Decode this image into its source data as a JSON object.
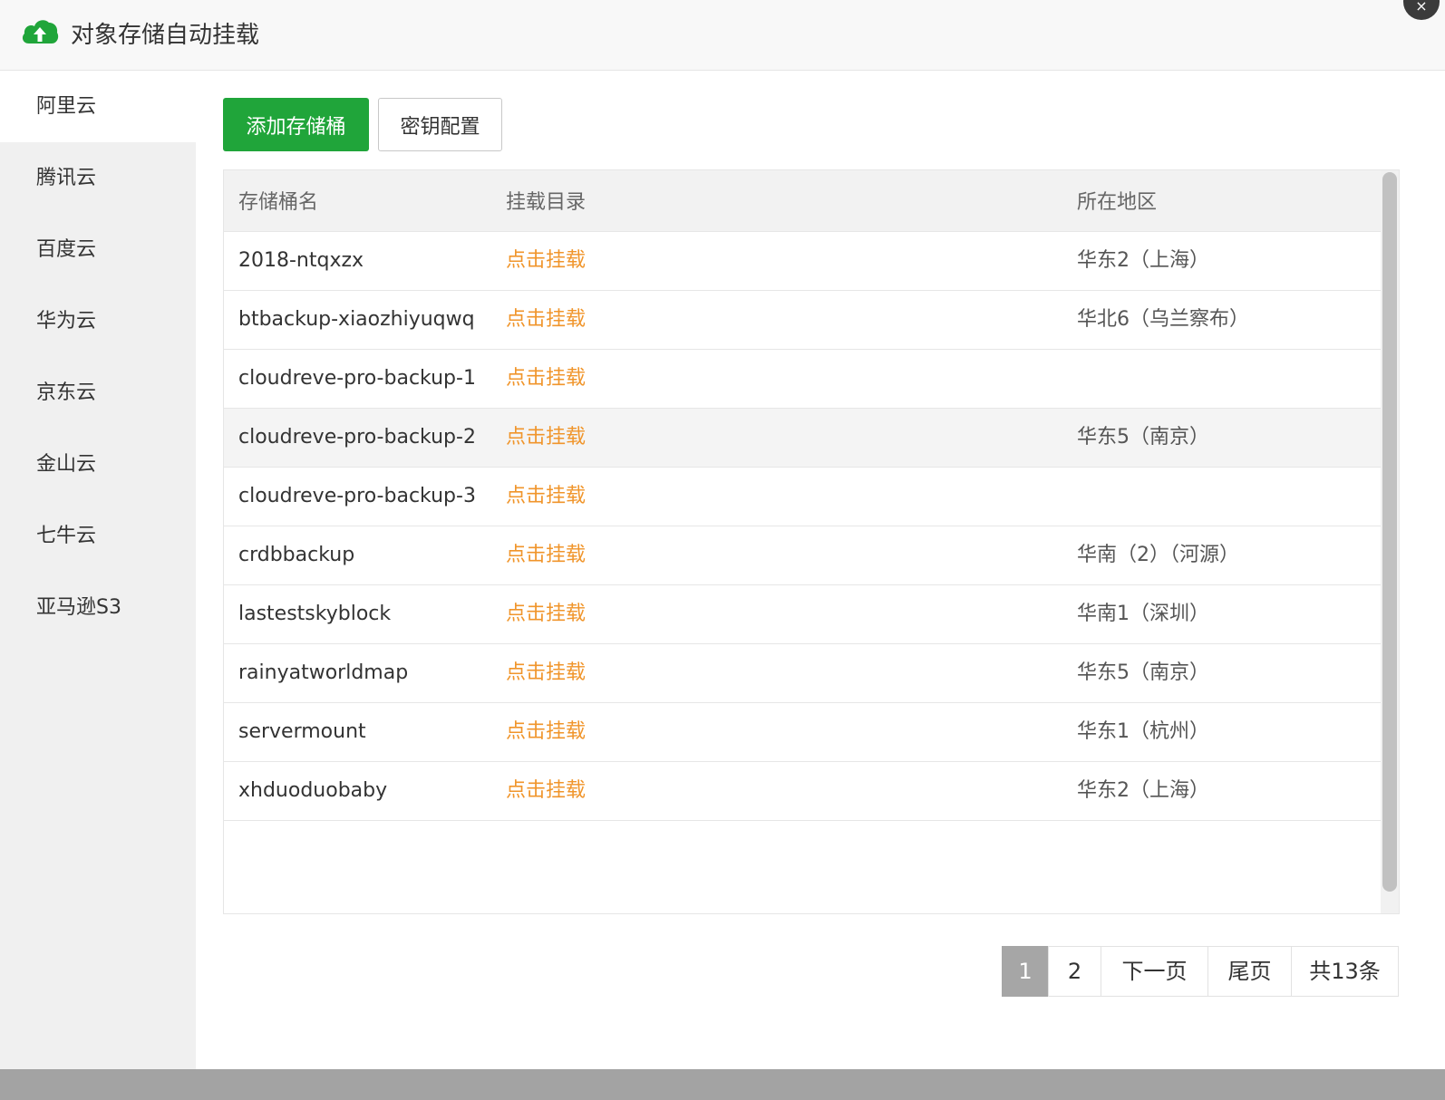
{
  "window": {
    "title": "对象存储自动挂载",
    "close_label": "×"
  },
  "sidebar": {
    "items": [
      {
        "label": "阿里云",
        "active": true
      },
      {
        "label": "腾讯云"
      },
      {
        "label": "百度云"
      },
      {
        "label": "华为云"
      },
      {
        "label": "京东云"
      },
      {
        "label": "金山云"
      },
      {
        "label": "七牛云"
      },
      {
        "label": "亚马逊S3"
      }
    ]
  },
  "toolbar": {
    "add_label": "添加存储桶",
    "key_label": "密钥配置"
  },
  "table": {
    "columns": [
      "存储桶名",
      "挂载目录",
      "所在地区"
    ],
    "rows": [
      {
        "name": "2018-ntqxzx",
        "mount": "点击挂载",
        "region": "华东2（上海）"
      },
      {
        "name": "btbackup-xiaozhiyuqwq",
        "mount": "点击挂载",
        "region": "华北6（乌兰察布）"
      },
      {
        "name": "cloudreve-pro-backup-1",
        "mount": "点击挂载",
        "region": ""
      },
      {
        "name": "cloudreve-pro-backup-2",
        "mount": "点击挂载",
        "region": "华东5（南京）"
      },
      {
        "name": "cloudreve-pro-backup-3",
        "mount": "点击挂载",
        "region": ""
      },
      {
        "name": "crdbbackup",
        "mount": "点击挂载",
        "region": "华南（2）（河源）"
      },
      {
        "name": "lastestskyblock",
        "mount": "点击挂载",
        "region": "华南1（深圳）"
      },
      {
        "name": "rainyatworldmap",
        "mount": "点击挂载",
        "region": "华东5（南京）"
      },
      {
        "name": "servermount",
        "mount": "点击挂载",
        "region": "华东1（杭州）"
      },
      {
        "name": "xhduoduobaby",
        "mount": "点击挂载",
        "region": "华东2（上海）"
      }
    ]
  },
  "pagination": {
    "current": "1",
    "page2": "2",
    "next": "下一页",
    "last": "尾页",
    "total": "共13条"
  },
  "colors": {
    "brand_green": "#20a53a",
    "link_orange": "#f0952b"
  },
  "icons": {
    "logo": "cloud-upload-icon",
    "close": "close-icon"
  }
}
